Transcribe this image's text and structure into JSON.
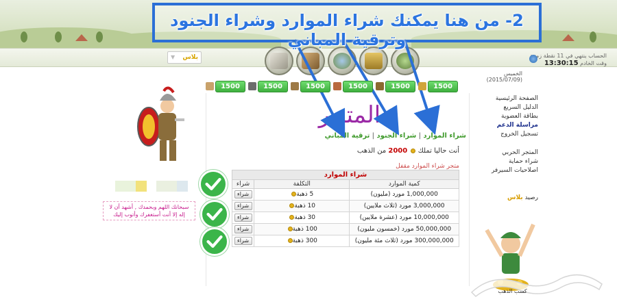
{
  "annotation": {
    "text": "2- من هنا يمكنك شراء الموارد وشراء الجنود وترقية المباني"
  },
  "header": {
    "server_line1": "الحساب ينتهي في 11 نقطة زمنية",
    "server_time_label": "وقت الخادم",
    "server_time": "13:30:15",
    "date": "الخميس (2015/07/09)",
    "username_select": "بلاس"
  },
  "nav_buttons": [
    {
      "name": "resources-nav"
    },
    {
      "name": "market-nav"
    },
    {
      "name": "map-nav"
    },
    {
      "name": "city-nav"
    },
    {
      "name": "world-nav"
    }
  ],
  "resources": [
    {
      "value": "1500",
      "color": "#c9a26b"
    },
    {
      "value": "1500",
      "color": "#6c6c6c"
    },
    {
      "value": "1500",
      "color": "#9e7a47"
    },
    {
      "value": "1500",
      "color": "#b96a3f"
    },
    {
      "value": "1500",
      "color": "#8b6a2f"
    },
    {
      "value": "1500",
      "color": "#d1a53a"
    }
  ],
  "sidebar": {
    "items": [
      {
        "label": "الصفحة الرئيسية",
        "strong": false
      },
      {
        "label": "الدليل السريع",
        "strong": false
      },
      {
        "label": "بطاقة العضوية",
        "strong": false
      },
      {
        "label": "مراسلة الدعم",
        "strong": true
      },
      {
        "label": "تسجيل الخروج",
        "strong": false
      }
    ],
    "items2": [
      {
        "label": "المتجر الحربي"
      },
      {
        "label": "شراء حماية"
      },
      {
        "label": "اصلاحيات السيرفر"
      }
    ],
    "balance_label": "رصيد",
    "balance_name": "بلاس"
  },
  "store": {
    "title": "المتجر",
    "link_resources": "شراء الموارد",
    "link_troops": "شراء الجنود",
    "link_buildings": "ترقية المباني",
    "gold_prefix": "أنت حاليا تملك",
    "gold_amount": "2000",
    "gold_suffix": "من الذهب",
    "closed_notice": "متجر شراء الموارد مقفل"
  },
  "table": {
    "caption": "شراء الموارد",
    "headers": {
      "quantity": "كمية الموارد",
      "cost": "التكلفة",
      "buy": "شراء"
    },
    "rows": [
      {
        "quantity": "1,000,000 مورد (مليون)",
        "cost": "5 ذهبة",
        "buy": "شراء"
      },
      {
        "quantity": "3,000,000 مورد (ثلاث ملايين)",
        "cost": "10 ذهبة",
        "buy": "شراء"
      },
      {
        "quantity": "10,000,000 مورد (عشرة ملايين)",
        "cost": "30 ذهبة",
        "buy": "شراء"
      },
      {
        "quantity": "50,000,000 مورد (خمسون مليون)",
        "cost": "100 ذهبة",
        "buy": "شراء"
      },
      {
        "quantity": "300,000,000 مورد (ثلاث مئة مليون)",
        "cost": "300 ذهبة",
        "buy": "شراء"
      }
    ]
  },
  "left": {
    "dua_line1": "سبحانك اللهم وبحمدك , أشهد أن لا",
    "dua_line2": "إله إلا أنت أستغفرك وأتوب إليك",
    "block_colors": [
      "#e9f3dc",
      "#f2e27c",
      "#eaf0e0",
      "#dde8ee"
    ]
  },
  "mascot": {
    "caption": "كسب الذهب"
  },
  "colors": {
    "accent": "#2b6fd6",
    "check": "#3bb54a",
    "store_title": "#9b2aa6"
  }
}
